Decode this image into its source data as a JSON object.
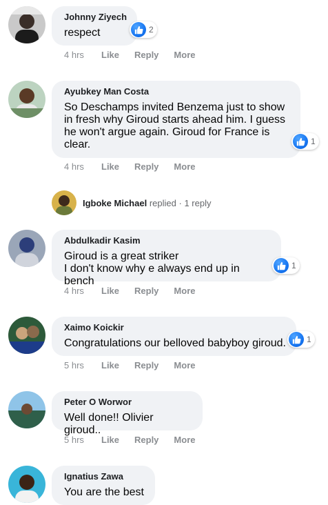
{
  "comments": [
    {
      "author": "Johnny Ziyech",
      "text": "respect",
      "reactions": "2",
      "time": "4 hrs",
      "actions": [
        "Like",
        "Reply",
        "More"
      ]
    },
    {
      "author": "Ayubkey Man Costa",
      "text": "So Deschamps invited Benzema just to show\nin fresh why Giroud starts ahead him. I guess\nhe won't argue again. Giroud for France is\nclear.",
      "reactions": "1",
      "time": "4 hrs",
      "actions": [
        "Like",
        "Reply",
        "More"
      ]
    },
    {
      "author": "Abdulkadir Kasim",
      "text": "Giroud is a great striker\nI don't know why e always end up in bench",
      "reactions": "1",
      "time": "4 hrs",
      "actions": [
        "Like",
        "Reply",
        "More"
      ]
    },
    {
      "author": "Xaimo Koickir",
      "text": "Congratulations our belloved babyboy giroud.",
      "reactions": "1",
      "time": "5 hrs",
      "actions": [
        "Like",
        "Reply",
        "More"
      ]
    },
    {
      "author": "Peter O Worwor",
      "text": "Well done!! Olivier giroud..",
      "time": "5 hrs",
      "actions": [
        "Like",
        "Reply",
        "More"
      ]
    },
    {
      "author": "Ignatius Zawa",
      "text": "You are the best"
    }
  ],
  "reply_thread": {
    "name": "Igboke Michael",
    "verb": "replied",
    "separator": "·",
    "count": "1 reply"
  },
  "colors": {
    "bubble": "#f0f2f5",
    "like_blue": "#1877f2",
    "meta_gray": "#8a8d91"
  },
  "icons": {
    "reaction": "thumbs-up-icon"
  }
}
